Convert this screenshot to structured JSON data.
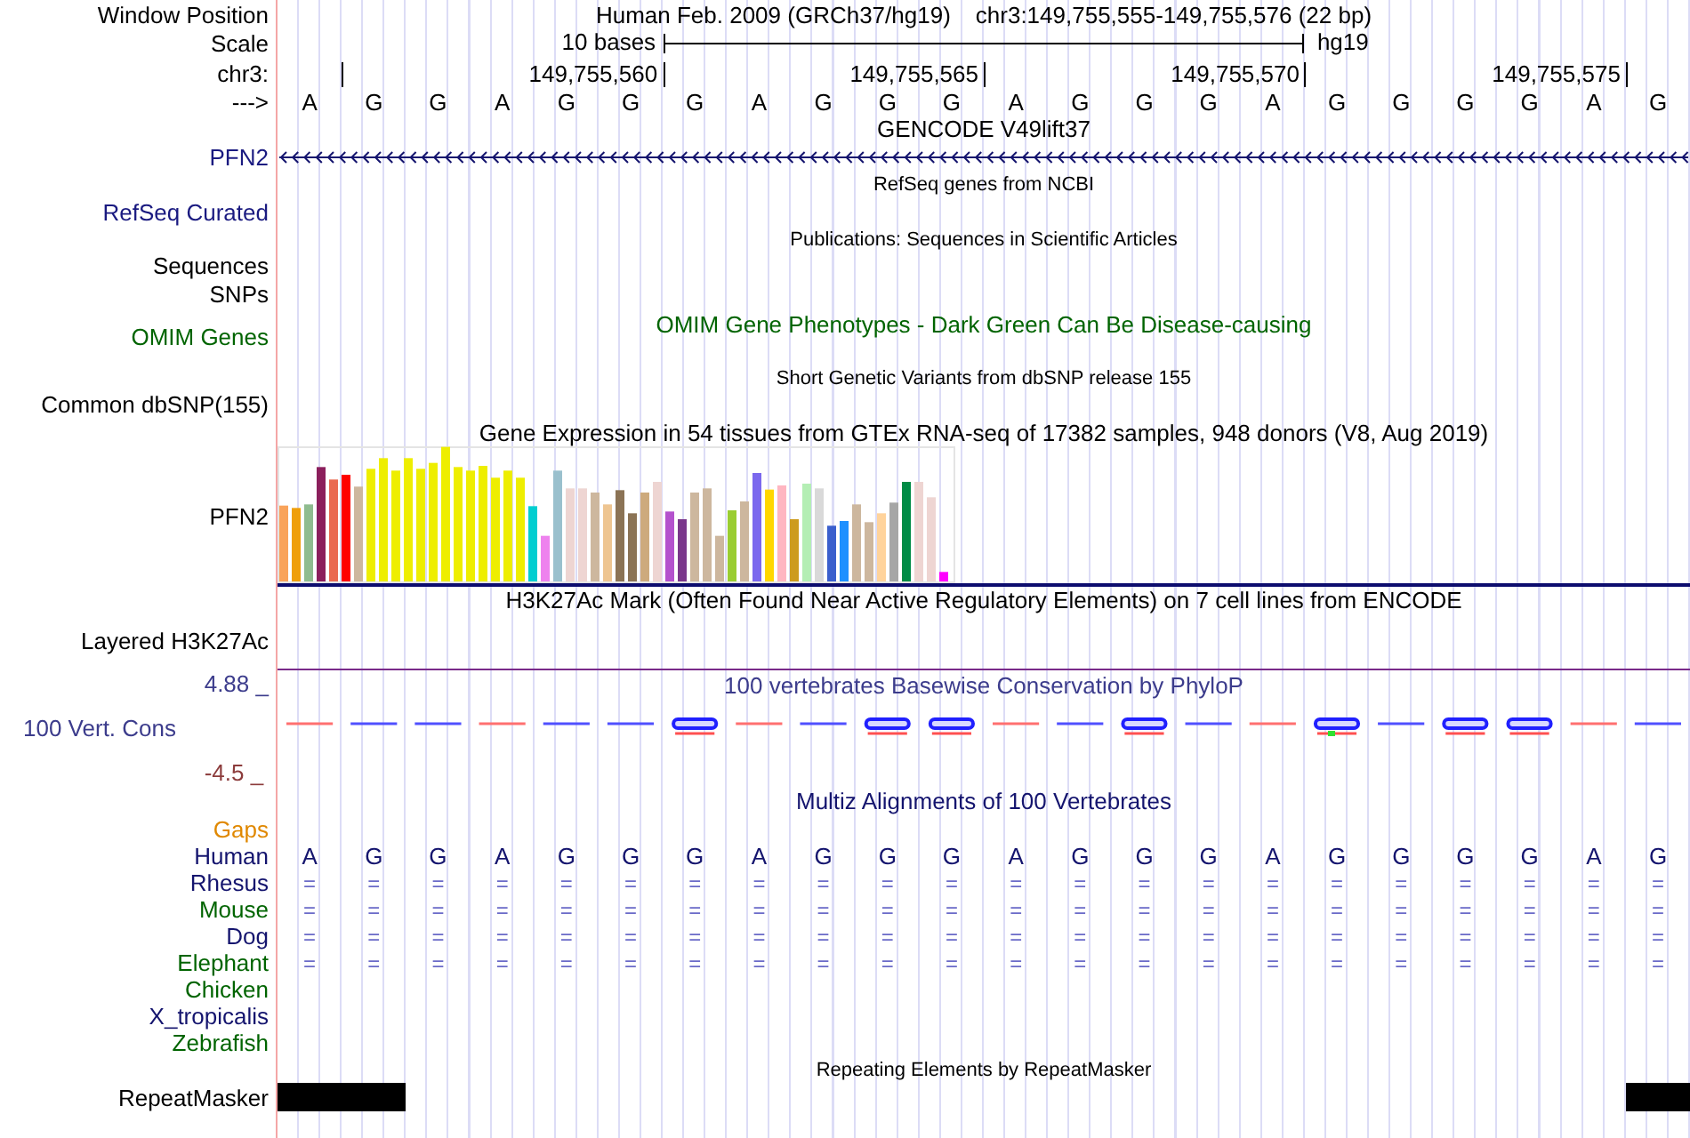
{
  "position_bar": {
    "label": "Window Position",
    "assembly": "Human Feb. 2009 (GRCh37/hg19)",
    "range": "chr3:149,755,555-149,755,576 (22 bp)"
  },
  "scale": {
    "label": "Scale",
    "length": "10 bases",
    "database": "hg19"
  },
  "coordinates": {
    "label": "chr3:",
    "ticks": [
      "149,755,560",
      "149,755,565",
      "149,755,570",
      "149,755,575"
    ]
  },
  "strand": {
    "label": "--->",
    "bases": [
      "A",
      "G",
      "G",
      "A",
      "G",
      "G",
      "G",
      "A",
      "G",
      "G",
      "G",
      "A",
      "G",
      "G",
      "G",
      "A",
      "G",
      "G",
      "G",
      "G",
      "A",
      "G"
    ]
  },
  "rows": [
    {
      "kind": "text",
      "title": {
        "text": "GENCODE V49lift37",
        "color": "#000000"
      }
    },
    {
      "kind": "gene",
      "label": {
        "text": "PFN2",
        "color": "#1a1a80"
      }
    },
    {
      "kind": "caption",
      "title": {
        "text": "RefSeq genes from NCBI",
        "color": "#000000"
      }
    },
    {
      "kind": "text",
      "label": {
        "text": "RefSeq Curated",
        "color": "#1a1a80"
      }
    },
    {
      "kind": "caption",
      "title": {
        "text": "Publications: Sequences in Scientific Articles",
        "color": "#000000"
      }
    },
    {
      "kind": "text",
      "label": {
        "text": "Sequences",
        "color": "#000000"
      }
    },
    {
      "kind": "text",
      "label": {
        "text": "SNPs",
        "color": "#000000"
      }
    },
    {
      "kind": "features",
      "label": {
        "text": "OMIM Genes",
        "color": "#006400"
      },
      "title": {
        "text": "OMIM Gene Phenotypes - Dark Green Can Be Disease-causing",
        "color": "#006400"
      }
    },
    {
      "kind": "caption",
      "title": {
        "text": "Short Genetic Variants from dbSNP release 155",
        "color": "#000000"
      }
    },
    {
      "kind": "text",
      "label": {
        "text": "Common dbSNP(155)",
        "color": "#000000"
      }
    },
    {
      "kind": "text",
      "title": {
        "text": "Gene Expression in 54 tissues from GTEx RNA-seq of 17382 samples, 948 donors (V8, Aug 2019)",
        "color": "#000000"
      }
    },
    {
      "kind": "expression",
      "label": {
        "text": "PFN2",
        "color": "#000000"
      }
    },
    {
      "kind": "text",
      "title": {
        "text": "H3K27Ac Mark (Often Found Near Active Regulatory Elements) on 7 cell lines from ENCODE",
        "color": "#000000"
      }
    },
    {
      "kind": "signal",
      "label": {
        "text": "Layered H3K27Ac",
        "color": "#000000"
      }
    },
    {
      "kind": "conservation",
      "label": {
        "text": "100 Vert. Cons",
        "color": "#3c3c8c"
      },
      "title": {
        "text": "100 vertebrates Basewise Conservation by PhyloP",
        "color": "#3c3c8c"
      },
      "scale_max": "4.88 _",
      "scale_min": "-4.5 _"
    },
    {
      "kind": "text",
      "title": {
        "text": "Multiz Alignments of 100 Vertebrates",
        "color": "#14146e"
      }
    },
    {
      "kind": "text",
      "label": {
        "text": "Gaps",
        "color": "#e08800"
      }
    },
    {
      "kind": "bases",
      "label": {
        "text": "Human",
        "color": "#14146e"
      },
      "bases": [
        "A",
        "G",
        "G",
        "A",
        "G",
        "G",
        "G",
        "A",
        "G",
        "G",
        "G",
        "A",
        "G",
        "G",
        "G",
        "A",
        "G",
        "G",
        "G",
        "G",
        "A",
        "G"
      ]
    },
    {
      "kind": "matches",
      "label": {
        "text": "Rhesus",
        "color": "#14146e"
      },
      "marks": [
        "=",
        "=",
        "=",
        "=",
        "=",
        "=",
        "=",
        "=",
        "=",
        "=",
        "=",
        "=",
        "=",
        "=",
        "=",
        "=",
        "=",
        "=",
        "=",
        "=",
        "=",
        "="
      ]
    },
    {
      "kind": "matches",
      "label": {
        "text": "Mouse",
        "color": "#006400"
      },
      "marks": [
        "=",
        "=",
        "=",
        "=",
        "=",
        "=",
        "=",
        "=",
        "=",
        "=",
        "=",
        "=",
        "=",
        "=",
        "=",
        "=",
        "=",
        "=",
        "=",
        "=",
        "=",
        "="
      ]
    },
    {
      "kind": "matches",
      "label": {
        "text": "Dog",
        "color": "#14146e"
      },
      "marks": [
        "=",
        "=",
        "=",
        "=",
        "=",
        "=",
        "=",
        "=",
        "=",
        "=",
        "=",
        "=",
        "=",
        "=",
        "=",
        "=",
        "=",
        "=",
        "=",
        "=",
        "=",
        "="
      ]
    },
    {
      "kind": "matches",
      "label": {
        "text": "Elephant",
        "color": "#006400"
      },
      "marks": [
        "=",
        "=",
        "=",
        "=",
        "=",
        "=",
        "=",
        "=",
        "=",
        "=",
        "=",
        "=",
        "=",
        "=",
        "=",
        "=",
        "=",
        "=",
        "=",
        "=",
        "=",
        "="
      ]
    },
    {
      "kind": "matches",
      "label": {
        "text": "Chicken",
        "color": "#006400"
      }
    },
    {
      "kind": "matches",
      "label": {
        "text": "X_tropicalis",
        "color": "#14146e"
      }
    },
    {
      "kind": "matches",
      "label": {
        "text": "Zebrafish",
        "color": "#006400"
      }
    },
    {
      "kind": "caption",
      "title": {
        "text": "Repeating Elements by RepeatMasker",
        "color": "#000000"
      }
    },
    {
      "kind": "repeat",
      "label": {
        "text": "RepeatMasker",
        "color": "#000000"
      }
    }
  ]
}
